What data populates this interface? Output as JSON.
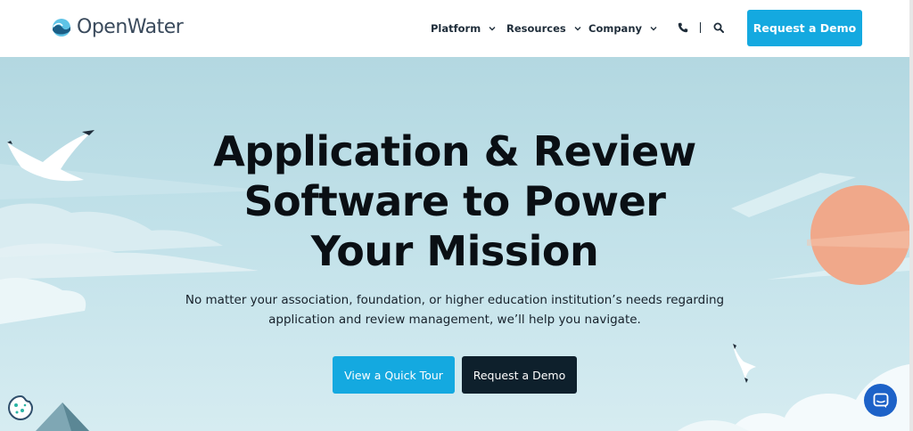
{
  "header": {
    "logo_text": "OpenWater",
    "nav": [
      {
        "label": "Platform"
      },
      {
        "label": "Resources"
      },
      {
        "label": "Company"
      }
    ],
    "icons": [
      "phone-icon",
      "search-icon"
    ],
    "cta_label": "Request a Demo"
  },
  "hero": {
    "title_lines": [
      "Application & Review",
      "Software to Power",
      "Your Mission"
    ],
    "subtitle_lines": [
      "No matter your association, foundation, or higher education institution’s needs regarding",
      "application and review management, we’ll help you navigate."
    ],
    "primary_button": "View a Quick Tour",
    "secondary_button": "Request a Demo"
  },
  "widgets": {
    "cookie_icon": "cookie-icon",
    "chat_icon": "chat-icon"
  },
  "colors": {
    "accent": "#14a9e0",
    "dark_button": "#0e202c",
    "sky_top": "#b3d8e1",
    "sun": "#f0a88a",
    "chat": "#1d62c8"
  }
}
